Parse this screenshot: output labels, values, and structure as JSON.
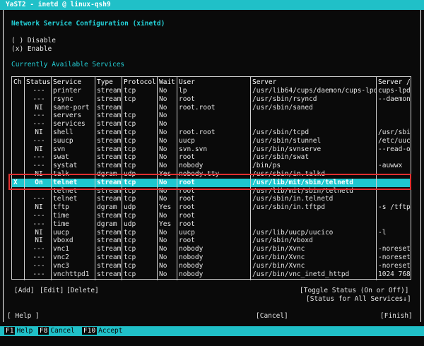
{
  "window": {
    "title": "YaST2 - inetd @ linux-qsh9"
  },
  "heading": "Network Service Configuration (xinetd)",
  "radios": [
    {
      "mark": "( )",
      "label": "Disable"
    },
    {
      "mark": "(x)",
      "label": "Enable"
    }
  ],
  "services_title": "Currently Available Services",
  "columns": [
    "Ch",
    "Status",
    "Service",
    "Type",
    "Protocol",
    "Wait",
    "User",
    "Server",
    "Server /"
  ],
  "rows": [
    [
      "",
      "---",
      "printer",
      "stream",
      "tcp",
      "No",
      "lp",
      "/usr/lib64/cups/daemon/cups-lpd",
      "cups-lpd"
    ],
    [
      "",
      "---",
      "rsync",
      "stream",
      "tcp",
      "No",
      "root",
      "/usr/sbin/rsyncd",
      "--daemon"
    ],
    [
      "",
      "NI",
      "sane-port",
      "stream",
      "",
      "No",
      "root.root",
      "/usr/sbin/saned",
      ""
    ],
    [
      "",
      "---",
      "servers",
      "stream",
      "tcp",
      "No",
      "",
      "",
      ""
    ],
    [
      "",
      "---",
      "services",
      "stream",
      "tcp",
      "No",
      "",
      "",
      ""
    ],
    [
      "",
      "NI",
      "shell",
      "stream",
      "tcp",
      "No",
      "root.root",
      "/usr/sbin/tcpd",
      "/usr/sbi"
    ],
    [
      "",
      "---",
      "suucp",
      "stream",
      "tcp",
      "No",
      "uucp",
      "/usr/sbin/stunnel",
      "/etc/uuc"
    ],
    [
      "",
      "NI",
      "svn",
      "stream",
      "tcp",
      "No",
      "svn.svn",
      "/usr/bin/svnserve",
      "--read-o"
    ],
    [
      "",
      "---",
      "swat",
      "stream",
      "tcp",
      "No",
      "root",
      "/usr/sbin/swat",
      ""
    ],
    [
      "",
      "---",
      "systat",
      "stream",
      "tcp",
      "No",
      "nobody",
      "/bin/ps",
      "-auwwx"
    ],
    [
      "",
      "NI",
      "talk",
      "dgram",
      "udp",
      "Yes",
      "nobody.tty",
      "/usr/sbin/in.talkd",
      ""
    ],
    [
      "X",
      "On",
      "telnet",
      "stream",
      "tcp",
      "No",
      "root",
      "/usr/lib/mit/sbin/telnetd",
      ""
    ],
    [
      "",
      "",
      "telnet",
      "stream",
      "tcp",
      "No",
      "root",
      "/usr/lib/mit/sbin/telnetd",
      ""
    ],
    [
      "",
      "---",
      "telnet",
      "stream",
      "tcp",
      "No",
      "root",
      "/usr/sbin/in.telnetd",
      ""
    ],
    [
      "",
      "NI",
      "tftp",
      "dgram",
      "udp",
      "Yes",
      "root",
      "/usr/sbin/in.tftpd",
      "-s /tftp"
    ],
    [
      "",
      "---",
      "time",
      "stream",
      "tcp",
      "No",
      "root",
      "",
      ""
    ],
    [
      "",
      "---",
      "time",
      "dgram",
      "udp",
      "Yes",
      "root",
      "",
      ""
    ],
    [
      "",
      "NI",
      "uucp",
      "stream",
      "tcp",
      "No",
      "uucp",
      "/usr/lib/uucp/uucico",
      "-l"
    ],
    [
      "",
      "NI",
      "vboxd",
      "stream",
      "tcp",
      "No",
      "root",
      "/usr/sbin/vboxd",
      ""
    ],
    [
      "",
      "---",
      "vnc1",
      "stream",
      "tcp",
      "No",
      "nobody",
      "/usr/bin/Xvnc",
      "-noreset"
    ],
    [
      "",
      "---",
      "vnc2",
      "stream",
      "tcp",
      "No",
      "nobody",
      "/usr/bin/Xvnc",
      "-noreset"
    ],
    [
      "",
      "---",
      "vnc3",
      "stream",
      "tcp",
      "No",
      "nobody",
      "/usr/bin/Xvnc",
      "-noreset"
    ],
    [
      "",
      "---",
      "vnchttpd1",
      "stream",
      "tcp",
      "No",
      "nobody",
      "/usr/bin/vnc_inetd_httpd",
      "1024 768"
    ]
  ],
  "actions": {
    "add": "[Add]",
    "edit": "[Edit]",
    "delete": "[Delete]",
    "toggle": "[Toggle Status (On or Off)]",
    "status_all": "[Status for All Services↓]"
  },
  "nav": {
    "help": "[ Help ]",
    "cancel": "[Cancel]",
    "finish": "[Finish]"
  },
  "fkeys": [
    {
      "key": "F1",
      "label": "Help"
    },
    {
      "key": "F8",
      "label": "Cancel"
    },
    {
      "key": "F10",
      "label": "Accept"
    }
  ],
  "colors": {
    "accent": "#20c0c8",
    "highlight": "#e03030"
  }
}
